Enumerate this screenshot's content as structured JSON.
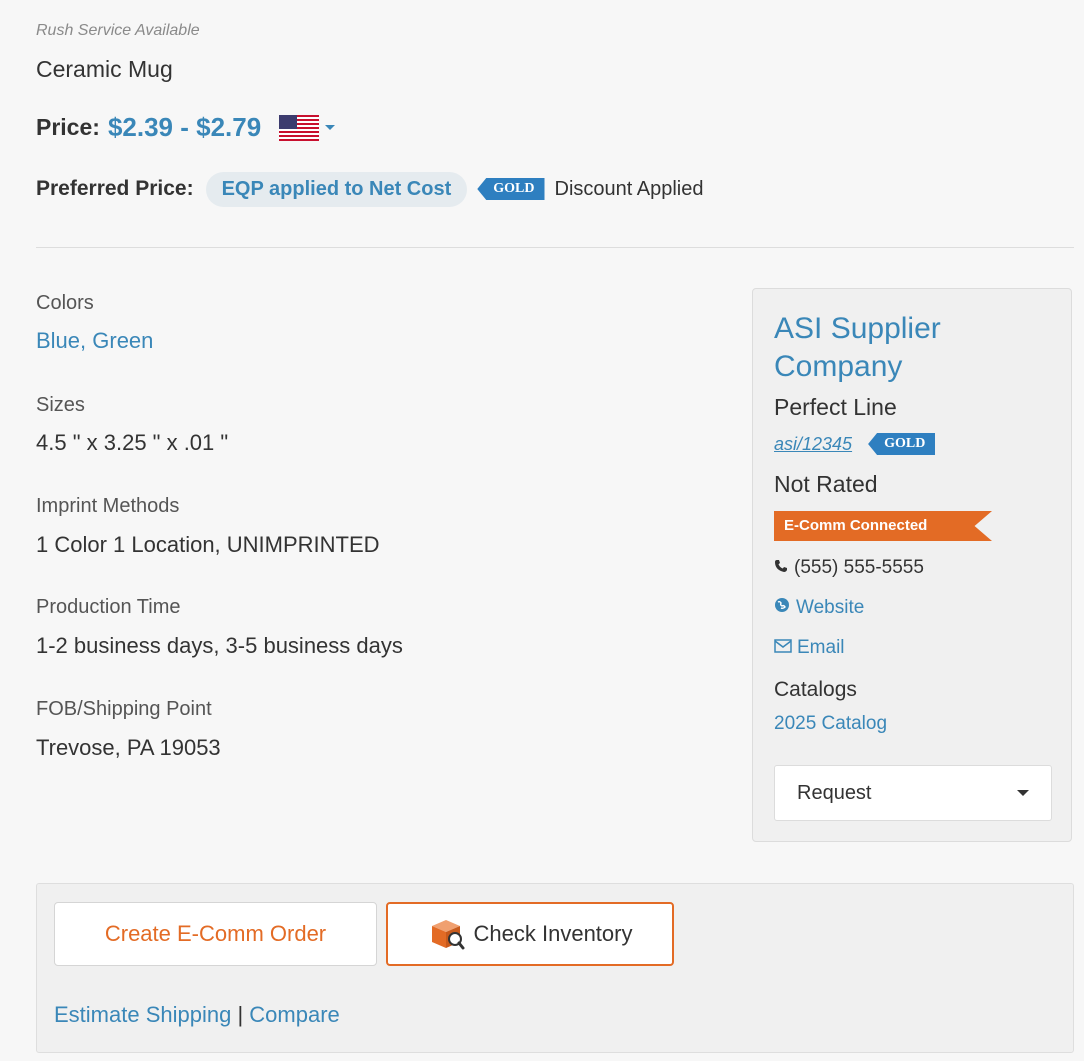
{
  "header": {
    "rush_service": "Rush Service Available",
    "product_name": "Ceramic Mug",
    "price_label": "Price:",
    "price_value": "$2.39 - $2.79",
    "preferred_label": "Preferred Price:",
    "preferred_pill": "EQP applied to Net Cost",
    "gold_badge": "GOLD",
    "discount_text": "Discount Applied"
  },
  "details": [
    {
      "label": "Colors",
      "value": "Blue, Green",
      "is_link": true
    },
    {
      "label": "Sizes",
      "value": "4.5 \" x 3.25 \" x .01 \"",
      "is_link": false
    },
    {
      "label": "Imprint Methods",
      "value": "1 Color 1 Location, UNIMPRINTED",
      "is_link": false
    },
    {
      "label": "Production Time",
      "value": "1-2 business days, 3-5 business days",
      "is_link": false
    },
    {
      "label": "FOB/Shipping Point",
      "value": "Trevose, PA 19053",
      "is_link": false
    }
  ],
  "supplier": {
    "company": "ASI Supplier Company",
    "line": "Perfect Line",
    "asi_number": "asi/12345",
    "gold_badge": "GOLD",
    "rating": "Not Rated",
    "ecomm_badge": "E-Comm Connected",
    "phone": "(555) 555-5555",
    "website": "Website",
    "email": "Email",
    "catalogs_label": "Catalogs",
    "catalog_link": "2025 Catalog",
    "request_select": "Request"
  },
  "actions": {
    "create_order": "Create E-Comm Order",
    "check_inventory": "Check Inventory",
    "estimate_shipping": "Estimate Shipping",
    "separator": "|",
    "compare": "Compare"
  },
  "colors": {
    "link_blue": "#3a87b8",
    "badge_blue": "#2e7fc0",
    "accent_orange": "#e36b25"
  }
}
